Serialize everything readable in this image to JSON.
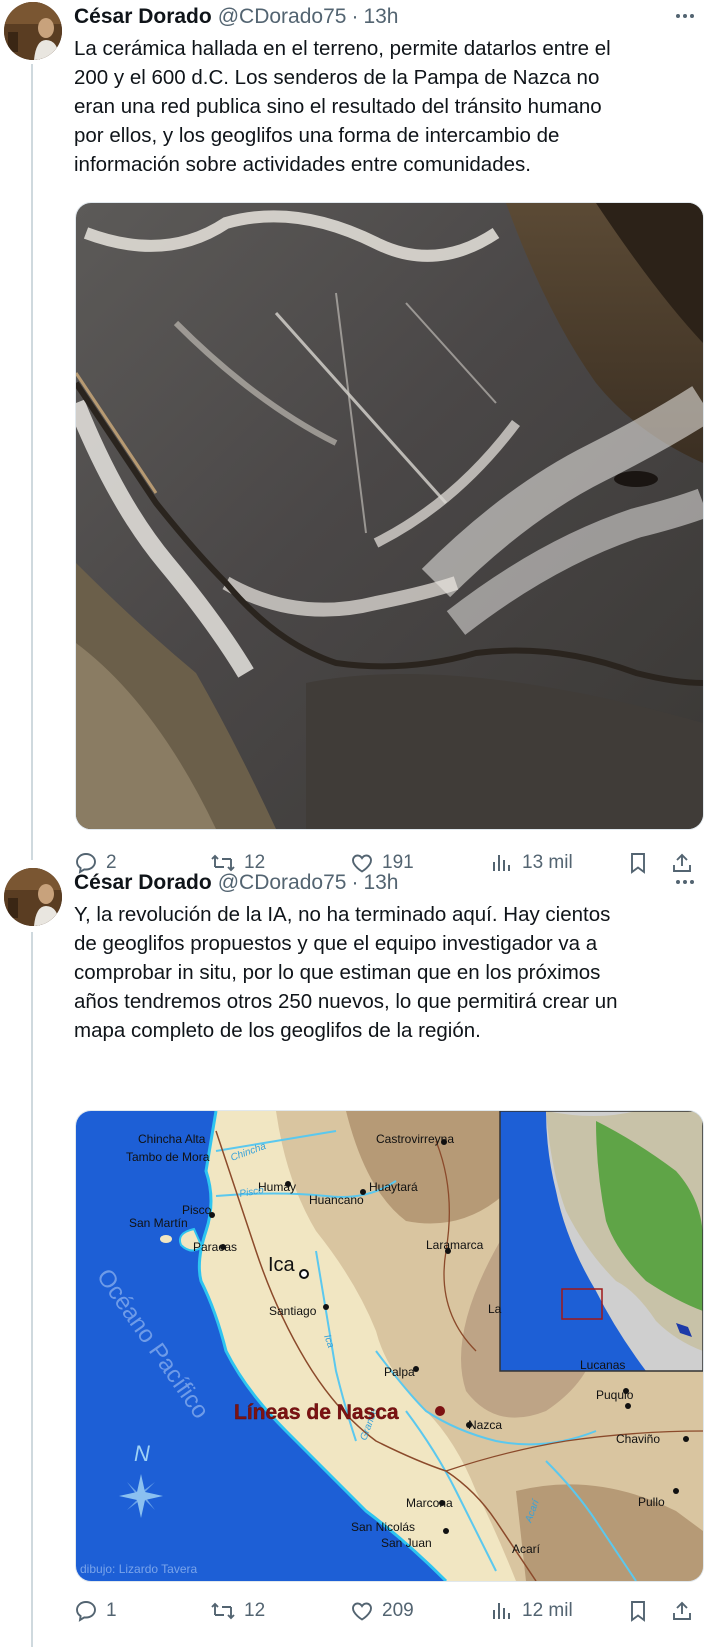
{
  "tweets": [
    {
      "author_name": "César Dorado",
      "author_handle": "@CDorado75",
      "separator": "·",
      "time": "13h",
      "text_lines": [
        "La cerámica hallada en el terreno, permite datarlos entre el",
        "200 y el 600 d.C. Los senderos de la Pampa de Nazca no",
        "eran una red publica sino el resultado del tránsito humano",
        "por ellos, y los geoglifos una forma de intercambio de",
        "información sobre actividades entre comunidades."
      ],
      "media": "satellite-image",
      "replies": "2",
      "retweets": "12",
      "likes": "191",
      "views": "13 mil"
    },
    {
      "author_name": "César Dorado",
      "author_handle": "@CDorado75",
      "separator": "·",
      "time": "13h",
      "text_lines": [
        "Y, la revolución de la IA, no ha terminado aquí. Hay cientos",
        "de geoglifos propuestos y que el equipo investigador va a",
        "comprobar in situ, por lo que estiman que en los próximos",
        "años tendremos otros 250 nuevos, lo que permitirá crear un",
        "mapa completo de los geoglifos de la región."
      ],
      "media": "map-image",
      "replies": "1",
      "retweets": "12",
      "likes": "209",
      "views": "12 mil"
    }
  ],
  "map": {
    "places": {
      "chincha": "Chincha Alta",
      "tambo": "Tambo de Mora",
      "castrovirreyna": "Castrovirreyna",
      "humay": "Humay",
      "huancano": "Huancano",
      "huaytara": "Huaytará",
      "pisco": "Pisco",
      "san_martin": "San Martín",
      "paracas": "Paracas",
      "ica": "Ica",
      "laramarca": "Laramarca",
      "santiago": "Santiago",
      "palpa": "Palpa",
      "lucanas": "Lucanas",
      "puquio": "Puquio",
      "nazca": "Nazca",
      "chavino": "Chaviño",
      "marcona": "Marcona",
      "pullo": "Pullo",
      "san_nicolas": "San Nicolás",
      "san_juan": "San Juan",
      "acari": "Acarí",
      "la": "La"
    },
    "rivers": {
      "chincha": "Chincha",
      "pisco": "Pisco",
      "ica": "Ica",
      "grande": "Grande",
      "acari": "Acarí"
    },
    "ocean_label": "Océano Pacífico",
    "highlight_label": "Líneas de Nasca",
    "compass_label": "N",
    "credit": "dibujo: Lizardo Tavera"
  }
}
